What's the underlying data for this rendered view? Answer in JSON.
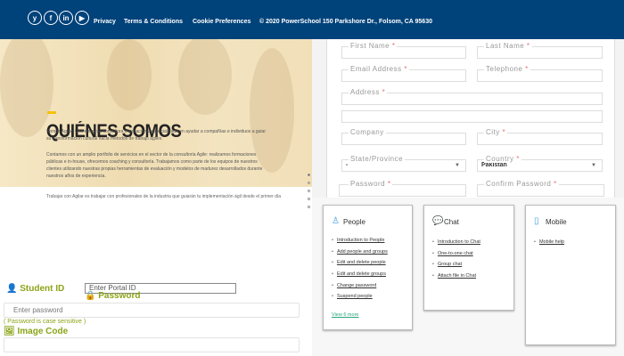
{
  "footer": {
    "social": [
      {
        "icon": "twitter-icon",
        "glyph": "y"
      },
      {
        "icon": "facebook-icon",
        "glyph": "f"
      },
      {
        "icon": "linkedin-icon",
        "glyph": "in"
      },
      {
        "icon": "youtube-icon",
        "glyph": "▶"
      }
    ],
    "links": [
      "Privacy",
      "Terms & Conditions",
      "Cookie Preferences"
    ],
    "copyright": "© 2020 PowerSchool 150 Parkshore Dr., Folsom, CA 95630"
  },
  "hero": {
    "title": "QUIÉNES SOMOS",
    "p1": "Somos Agilar. Una empresa consultora internacional especializada en ayudar a compañías e individuos a guiar su transformación cultural hacia métodos de trabajo ágiles.",
    "p2": "Contamos con un amplio portfolio de servicios en el sector de la consultoría Agile: realizamos formaciones públicas e in-house, ofrecemos coaching y consultoría. Trabajamos como parte de los equipos de nuestros clientes utilizando nuestras propias herramientas de evaluación y modelos de madurez desarrollados durante nuestros años de experiencia.",
    "p3": "Trabajar con Agilar es trabajar con profesionales de la industria que guiarán tu implementación ágil desde el primer día"
  },
  "form": {
    "first_name": "First Name",
    "last_name": "Last Name",
    "email": "Email Address",
    "telephone": "Telephone",
    "address": "Address",
    "company": "Company",
    "city": "City",
    "state": "State/Province",
    "state_value": "-",
    "country": "Country",
    "country_value": "Pakistan",
    "password": "Password",
    "confirm_password": "Confirm Password",
    "required_mark": "*"
  },
  "cards": [
    {
      "title": "People",
      "icon": "person-icon",
      "items": [
        "Introduction to People",
        "Add people and groups",
        "Edit and delete people",
        "Edit and delete groups",
        "Change password",
        "Suspend people"
      ],
      "more": "View 6 more"
    },
    {
      "title": "Chat",
      "icon": "chat-icon",
      "items": [
        "Introduction to Chat",
        "One-to-one chat",
        "Group chat",
        "Attach file in Chat"
      ]
    },
    {
      "title": "Mobile",
      "icon": "mobile-icon",
      "items": [
        "Mobile help"
      ]
    }
  ],
  "login": {
    "student_id": "Student ID",
    "portal_placeholder": "Enter Portal ID",
    "password": "Password",
    "password_placeholder": "Enter password",
    "hint": "( Password is case sensitive )",
    "image_code": "Image Code"
  }
}
